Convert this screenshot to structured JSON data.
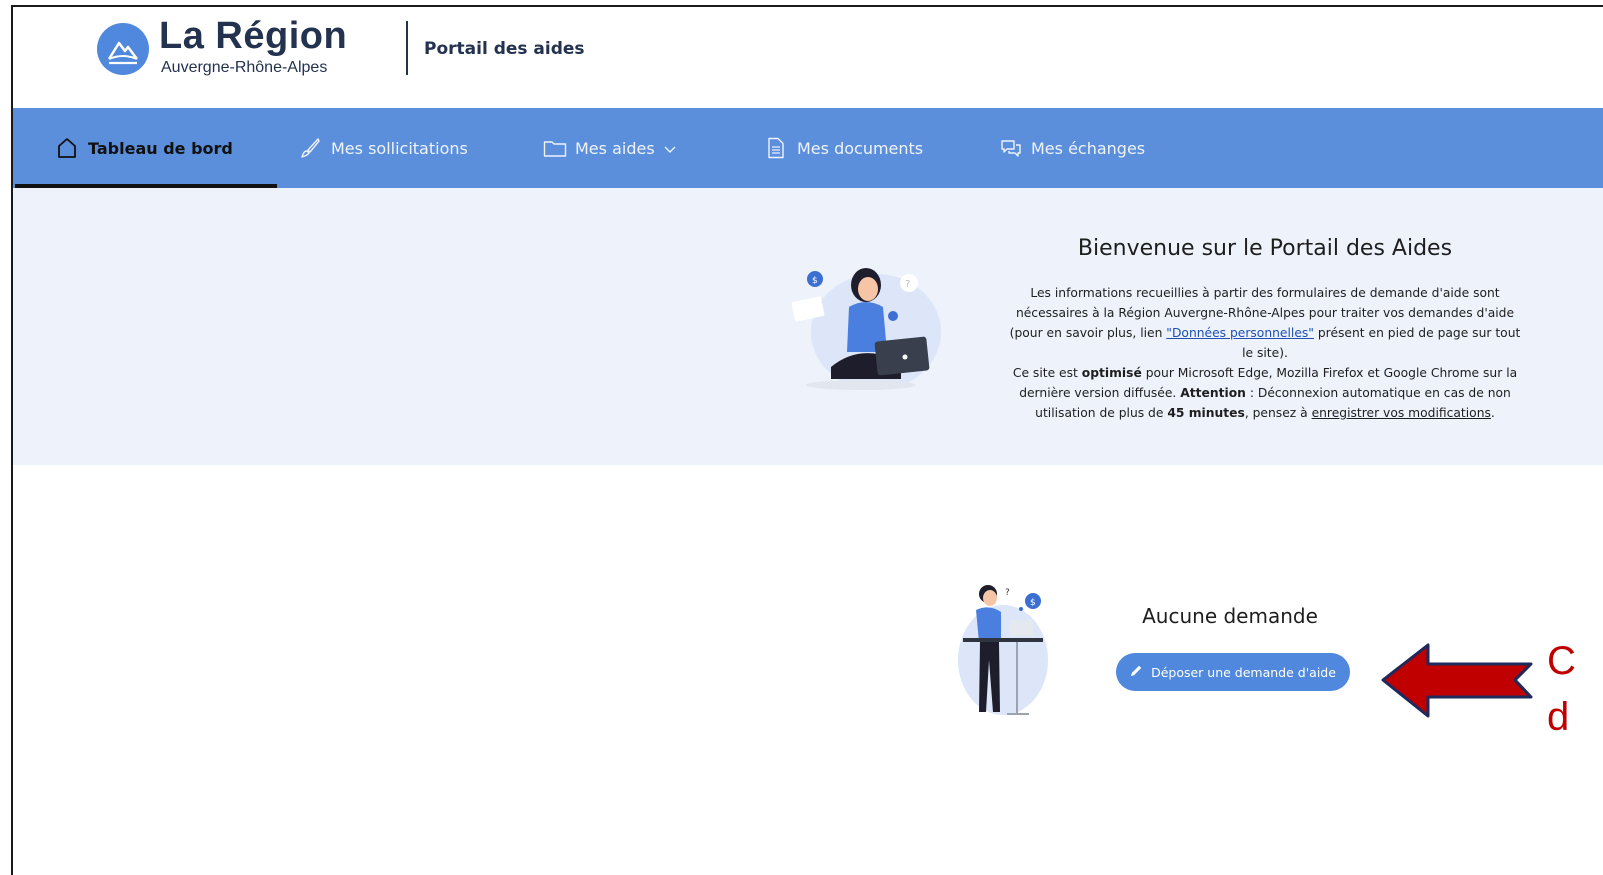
{
  "header": {
    "logo_title": "La Région",
    "logo_subtitle": "Auvergne-Rhône-Alpes",
    "portal_title": "Portail des aides"
  },
  "nav": {
    "items": [
      {
        "label": "Tableau de bord",
        "icon": "home-icon",
        "active": true
      },
      {
        "label": "Mes sollicitations",
        "icon": "brush-icon"
      },
      {
        "label": "Mes aides",
        "icon": "folder-icon",
        "has_dropdown": true
      },
      {
        "label": "Mes documents",
        "icon": "document-icon"
      },
      {
        "label": "Mes échanges",
        "icon": "chat-icon"
      }
    ]
  },
  "hero": {
    "title": "Bienvenue sur le Portail des Aides",
    "p1_part1": "Les informations recueillies à partir des formulaires de demande d'aide sont nécessaires à la Région Auvergne-Rhône-Alpes pour traiter vos demandes d'aide (pour en savoir plus, lien ",
    "p1_link": "\"Données personnelles\"",
    "p1_part2": " présent en pied de page sur tout le site).",
    "p2_part1": "Ce site est ",
    "p2_bold1": "optimisé",
    "p2_part2": " pour Microsoft Edge, Mozilla Firefox et Google Chrome sur la dernière version diffusée. ",
    "p2_bold2": "Attention",
    "p2_part3": " : Déconnexion automatique en cas de non utilisation de plus de ",
    "p2_bold3": "45 minutes",
    "p2_part4": ", pensez à ",
    "p2_underline": "enregistrer vos modifications",
    "p2_end": "."
  },
  "empty_state": {
    "title": "Aucune demande",
    "button_label": "Déposer une demande d'aide"
  },
  "annotation": {
    "line1": "C",
    "line2": "d"
  },
  "colors": {
    "primary": "#4f88dc",
    "nav_bg": "#5b8fdc",
    "hero_bg": "#edf2fb",
    "brand_text": "#23324f",
    "annotation_red": "#c00000"
  }
}
